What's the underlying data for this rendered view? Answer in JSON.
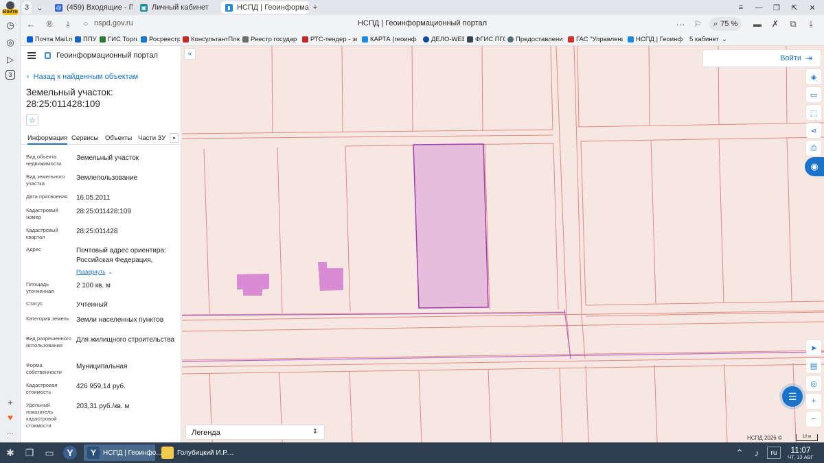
{
  "browser": {
    "rail_login_label": "Войти",
    "rail_badge_count": "3",
    "tab_counter": "3",
    "tabs": [
      {
        "label": "(459) Входящие - Почта М"
      },
      {
        "label": "Личный кабинет"
      },
      {
        "label": "НСПД | Геоинформаци",
        "close": "✕"
      }
    ],
    "new_tab": "+",
    "url": "nspd.gov.ru",
    "page_title": "НСПД | Геоинформационный портал",
    "zoom": "75 %",
    "bookmarks": [
      {
        "label": "Почта Mail.ru",
        "color": "#0a5dd8"
      },
      {
        "label": "ППУ",
        "color": "#1565c0"
      },
      {
        "label": "ГИС Торги",
        "color": "#2e7d32"
      },
      {
        "label": "Росреестр",
        "color": "#1976d2"
      },
      {
        "label": "КонсультантПлюс",
        "color": "#c62828"
      },
      {
        "label": "Реестр государст",
        "color": "#6d6d6d"
      },
      {
        "label": "РТС-тендер - эле",
        "color": "#c62828"
      },
      {
        "label": "КАРТА (геоинфо",
        "color": "#1e88e5"
      },
      {
        "label": "ДЕЛО-WEB",
        "color": "#0d47a1"
      },
      {
        "label": "ФГИС ПГС",
        "color": "#37474f"
      },
      {
        "label": "Предоставление",
        "color": "#546e7a"
      },
      {
        "label": "ГАС \"Управление",
        "color": "#d32f2f"
      },
      {
        "label": "НСПД | Геоинфор",
        "color": "#1e88e5"
      },
      {
        "label": "5 кабинет",
        "color": "#f3f4f6"
      }
    ]
  },
  "panel": {
    "portal_name": "Геоинформационный портал",
    "back_link": "Назад к найденным объектам",
    "title_line1": "Земельный участок:",
    "title_line2": "28:25:011428:109",
    "tabs": [
      "Информация",
      "Сервисы",
      "Объекты",
      "Части ЗУ"
    ],
    "expand_link": "Развернуть",
    "properties": [
      {
        "label": "Вид объекта недвижимости",
        "value": "Земельный участок"
      },
      {
        "label": "Вид земельного участка",
        "value": "Землепользование"
      },
      {
        "label": "Дата присвоения",
        "value": "16.05.2011"
      },
      {
        "label": "Кадастровый номер",
        "value": "28:25:011428:109"
      },
      {
        "label": "Кадастровый квартал",
        "value": "28:25:011428"
      },
      {
        "label": "Адрес",
        "value": "Почтовый адрес ориентира: Российская Федерация,"
      },
      {
        "label": "Площадь уточненная",
        "value": "2 100 кв. м"
      },
      {
        "label": "Статус",
        "value": "Учтенный"
      },
      {
        "label": "Категория земель",
        "value": "Земли населенных пунктов"
      },
      {
        "label": "Вид разрешенного использования",
        "value": "Для жилищного строительства"
      },
      {
        "label": "Форма собственности",
        "value": "Муниципальная"
      },
      {
        "label": "Кадастровая стоимость",
        "value": "426 959,14 руб."
      },
      {
        "label": "Удельный показатель кадастровой стоимости",
        "value": "203,31 руб./кв. м"
      }
    ]
  },
  "map": {
    "login_label": "Войти",
    "legend_label": "Легенда",
    "copyright": "НСПД 2026 ©",
    "scale_label": "10 м",
    "colors": {
      "background": "#f6e7e2",
      "parcel_line": "#e28a83",
      "selected_fill": "#e6bedb",
      "selected_stroke": "#a23bb0",
      "building": "#d98bd3",
      "accent": "#1a73c8"
    }
  },
  "taskbar": {
    "apps": [
      {
        "label": "НСПД | Геоинфо..."
      },
      {
        "label": "Голубицкий И.Р...."
      }
    ],
    "lang": "ru",
    "time": "11:07",
    "date": "ЧТ, 13 АВГ"
  }
}
